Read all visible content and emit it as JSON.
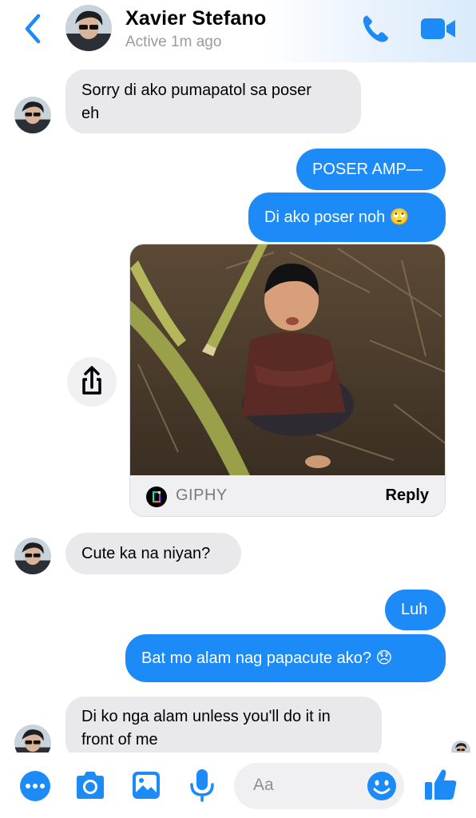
{
  "header": {
    "name": "Xavier Stefano",
    "status": "Active 1m ago"
  },
  "messages": [
    {
      "sender": "them",
      "text": "Sorry di ako pumapatol sa poser eh"
    },
    {
      "sender": "me",
      "text": "POSER AMP—"
    },
    {
      "sender": "me",
      "text": "Di ako poser noh 🙄"
    },
    {
      "sender": "me",
      "type": "gif",
      "source": "GIPHY",
      "action": "Reply"
    },
    {
      "sender": "them",
      "text": "Cute ka na niyan?"
    },
    {
      "sender": "me",
      "text": "Luh"
    },
    {
      "sender": "me",
      "text": "Bat mo alam nag papacute ako? 😞"
    },
    {
      "sender": "them",
      "text": "Di ko nga alam unless you'll do it in front of me"
    }
  ],
  "bubble_lines": {
    "m0_line1": "Sorry di ako pumapatol sa poser",
    "m0_line2": "eh",
    "m7_line1": "Di ko nga alam unless you'll do it in",
    "m7_line2": "front of me"
  },
  "composer": {
    "placeholder": "Aa"
  },
  "colors": {
    "accent": "#1d8bf7",
    "them_bubble": "#e9e9eb",
    "status_text": "#9a9aa0"
  },
  "icons": [
    "back-chevron-icon",
    "phone-icon",
    "video-camera-icon",
    "share-icon",
    "giphy-logo-icon",
    "more-dots-icon",
    "camera-icon",
    "gallery-icon",
    "microphone-icon",
    "emoji-icon",
    "thumbs-up-icon"
  ]
}
